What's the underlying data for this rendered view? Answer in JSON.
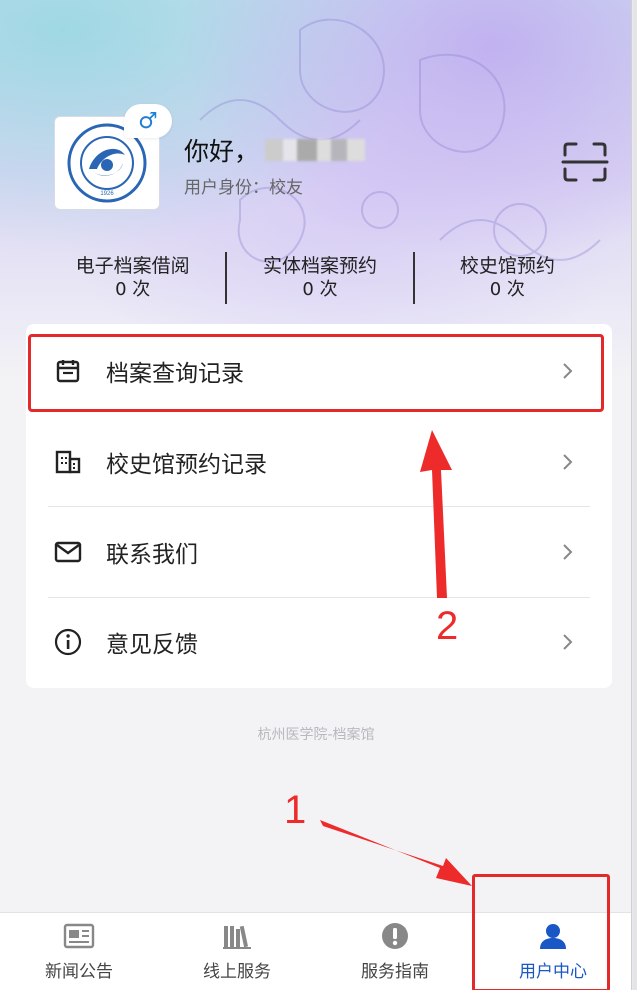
{
  "profile": {
    "greeting": "你好，",
    "identity": "用户身份：校友",
    "gender_symbol": "♂",
    "logo_text_top": "杭州医学院",
    "logo_text_ring": "HANGZHOU MEDICAL COLLEGE",
    "logo_year": "1926"
  },
  "stats": [
    {
      "label": "电子档案借阅",
      "value": "0 次"
    },
    {
      "label": "实体档案预约",
      "value": "0 次"
    },
    {
      "label": "校史馆预约",
      "value": "0 次"
    }
  ],
  "menu": [
    {
      "label": "档案查询记录",
      "icon": "calendar-icon"
    },
    {
      "label": "校史馆预约记录",
      "icon": "building-icon"
    },
    {
      "label": "联系我们",
      "icon": "mail-icon"
    },
    {
      "label": "意见反馈",
      "icon": "info-icon"
    }
  ],
  "footer_note": "杭州医学院-档案馆",
  "annotations": {
    "one": "1",
    "two": "2",
    "color": "#e22a2a"
  },
  "tabs": [
    {
      "label": "新闻公告",
      "icon": "news-icon"
    },
    {
      "label": "线上服务",
      "icon": "books-icon"
    },
    {
      "label": "服务指南",
      "icon": "alert-icon"
    },
    {
      "label": "用户中心",
      "icon": "user-icon",
      "active": true
    }
  ],
  "colors": {
    "accent": "#1a57c6",
    "highlight": "#e22a2a",
    "badge": "#1e7fd6"
  }
}
